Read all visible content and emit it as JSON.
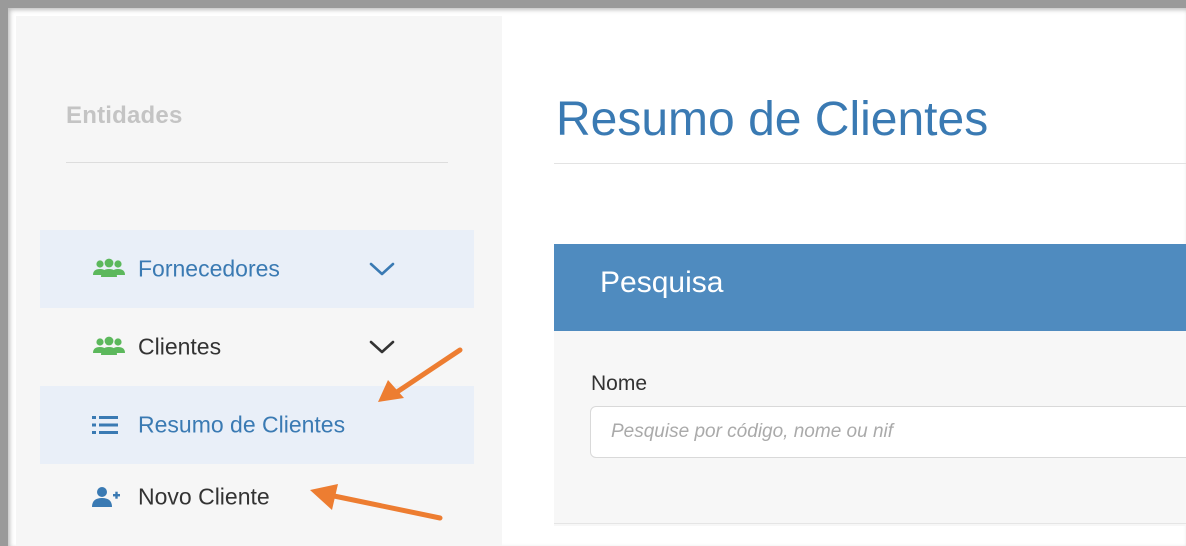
{
  "sidebar": {
    "title": "Entidades",
    "items": [
      {
        "label": "Fornecedores",
        "icon": "users-icon",
        "has_chevron": true,
        "active": true
      },
      {
        "label": "Clientes",
        "icon": "users-icon",
        "has_chevron": true,
        "active": false
      },
      {
        "label": "Resumo de Clientes",
        "icon": "list-icon",
        "has_chevron": false,
        "active": true
      },
      {
        "label": "Novo Cliente",
        "icon": "user-plus-icon",
        "has_chevron": false,
        "active": false
      }
    ]
  },
  "main": {
    "title": "Resumo de Clientes",
    "search_panel": {
      "title": "Pesquisa",
      "field_label": "Nome",
      "placeholder": "Pesquise por código, nome ou nif",
      "value": ""
    }
  },
  "colors": {
    "sidebar_bg": "#f6f6f6",
    "active_item_bg": "#e9eff8",
    "link_blue": "#3a7ab3",
    "icon_green": "#5cb85c",
    "panel_header": "#4f8bbf",
    "annotation_arrow": "#ed7d31"
  }
}
